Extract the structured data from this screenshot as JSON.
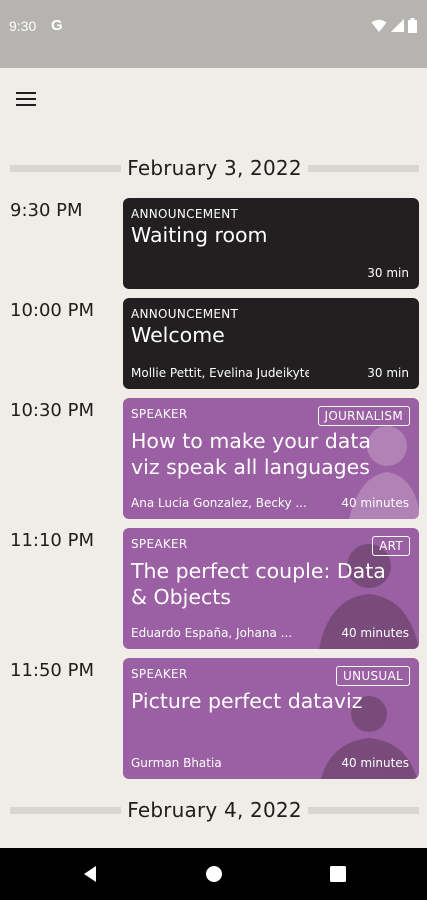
{
  "status_bar": {
    "time": "9:30",
    "g_label": "G"
  },
  "dates": [
    "February 3, 2022",
    "February 4, 2022"
  ],
  "slots": [
    {
      "time": "9:30 PM",
      "kind": "ANNOUNCEMENT",
      "title_line1": "Waiting room",
      "title_line2": "",
      "people": "",
      "duration": "30 min",
      "tag": ""
    },
    {
      "time": "10:00 PM",
      "kind": "ANNOUNCEMENT",
      "title_line1": "Welcome",
      "title_line2": "",
      "people": "Mollie Pettit, Evelina Judeikyte",
      "duration": "30 min",
      "tag": ""
    },
    {
      "time": "10:30 PM",
      "kind": "SPEAKER",
      "title_line1": "How to make your data",
      "title_line2": "viz speak all languages",
      "people": "Ana Lucia Gonzalez, Becky ...",
      "duration": "40 minutes",
      "tag": "JOURNALISM"
    },
    {
      "time": "11:10 PM",
      "kind": "SPEAKER",
      "title_line1": "The perfect couple: Data",
      "title_line2": "& Objects",
      "people": "Eduardo España, Johana ...",
      "duration": "40 minutes",
      "tag": "ART"
    },
    {
      "time": "11:50 PM",
      "kind": "SPEAKER",
      "title_line1": "Picture perfect dataviz",
      "title_line2": "",
      "people": "Gurman Bhatia",
      "duration": "40 minutes",
      "tag": "UNUSUAL"
    }
  ],
  "colors": {
    "announcement": "#221f20",
    "speaker": "#9b5fa3",
    "background": "#f0ede8"
  },
  "icons": {
    "menu": "menu-icon",
    "wifi": "wifi-icon",
    "signal": "signal-icon",
    "battery": "battery-icon",
    "back": "back-icon",
    "home": "home-icon",
    "recents": "recents-icon"
  }
}
